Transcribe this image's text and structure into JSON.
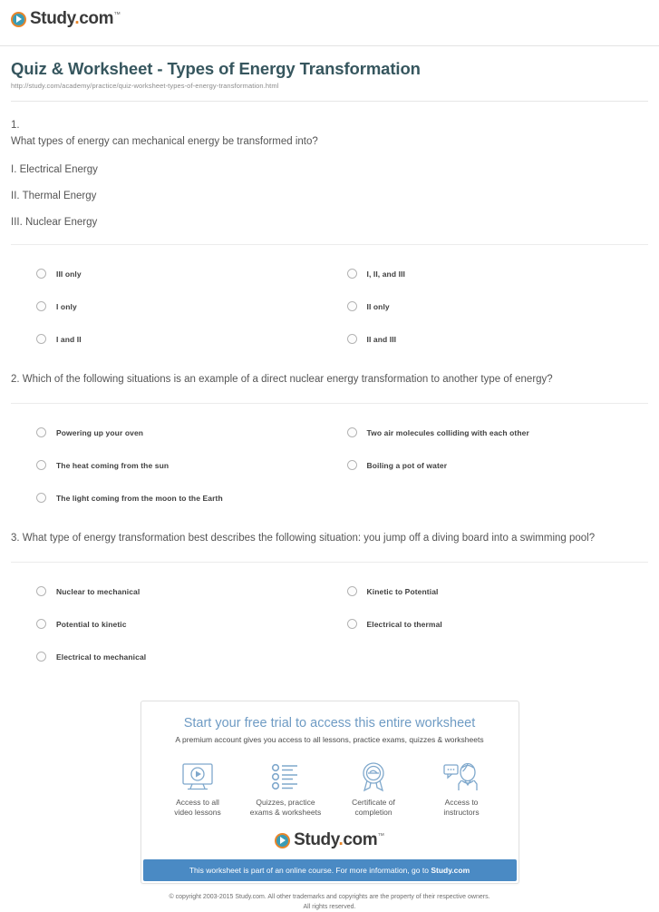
{
  "brand": {
    "name_main": "Study",
    "name_dot": ".",
    "name_tld": "com",
    "trademark": "™"
  },
  "header": {
    "title": "Quiz & Worksheet - Types of Energy Transformation",
    "url": "http://study.com/academy/practice/quiz-worksheet-types-of-energy-transformation.html"
  },
  "questions": [
    {
      "number": "1.",
      "text": "What types of energy can mechanical energy be transformed into?",
      "statements": [
        "I. Electrical Energy",
        "II. Thermal Energy",
        "III. Nuclear Energy"
      ],
      "options": [
        "III only",
        "I only",
        "I and II",
        "I, II, and III",
        "II only",
        "II and III"
      ]
    },
    {
      "number": "",
      "text": "2. Which of the following situations is an example of a direct nuclear energy transformation to another type of energy?",
      "statements": [],
      "options": [
        "Powering up your oven",
        "The heat coming from the sun",
        "The light coming from the moon to the Earth",
        "Two air molecules colliding with each other",
        "Boiling a pot of water",
        ""
      ]
    },
    {
      "number": "",
      "text": "3. What type of energy transformation best describes the following situation: you jump off a diving board into a swimming pool?",
      "statements": [],
      "options": [
        "Nuclear to mechanical",
        "Potential to kinetic",
        "Electrical to mechanical",
        "Kinetic to Potential",
        "Electrical to thermal",
        ""
      ]
    }
  ],
  "promo": {
    "title": "Start your free trial to access this entire worksheet",
    "subtitle": "A premium account gives you access to all lessons, practice exams, quizzes & worksheets",
    "features": [
      {
        "icon": "monitor-play-icon",
        "line1": "Access to all",
        "line2": "video lessons"
      },
      {
        "icon": "checklist-icon",
        "line1": "Quizzes, practice",
        "line2": "exams & worksheets"
      },
      {
        "icon": "award-ribbon-icon",
        "line1": "Certificate of",
        "line2": "completion"
      },
      {
        "icon": "instructor-chat-icon",
        "line1": "Access to",
        "line2": "instructors"
      }
    ],
    "bar_text": "This worksheet is part of an online course. For more information, go to ",
    "bar_link": "Study.com"
  },
  "footer": {
    "line1": "© copyright 2003-2015 Study.com. All other trademarks and copyrights are the property of their respective owners.",
    "line2": "All rights reserved."
  },
  "colors": {
    "title": "#36565e",
    "promo_title": "#6e9bc4",
    "promo_bar": "#4a8ac4",
    "brand_orange": "#e8852a",
    "brand_teal": "#3a9cb5",
    "icon_blue": "#7fa8cc"
  }
}
